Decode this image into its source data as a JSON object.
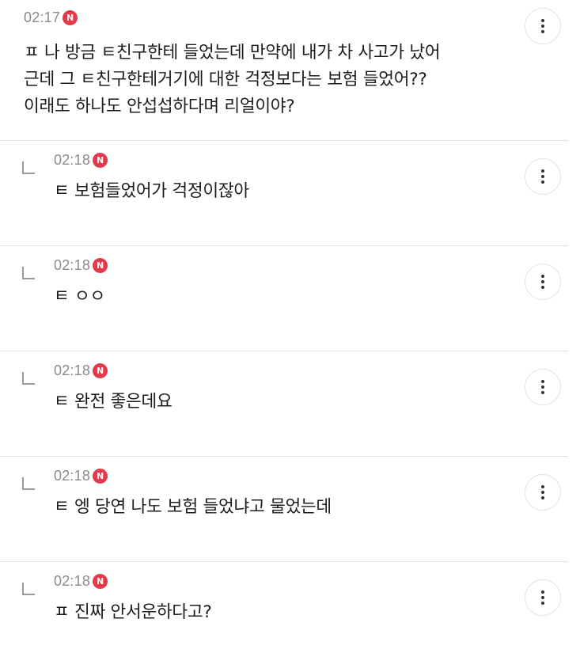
{
  "badge_label": "N",
  "comments": [
    {
      "time": "02:17",
      "text": "ㅍ 나 방금 ㅌ친구한테 들었는데 만약에 내가 차 사고가 났어\n근데 그 ㅌ친구한테거기에 대한 걱정보다는 보험 들었어??\n이래도 하나도 안섭섭하다며 리얼이야?"
    },
    {
      "time": "02:18",
      "text": "ㅌ 보험들었어가 걱정이잖아"
    },
    {
      "time": "02:18",
      "text": "ㅌ ㅇㅇ"
    },
    {
      "time": "02:18",
      "text": "ㅌ 완전 좋은데요"
    },
    {
      "time": "02:18",
      "text": "ㅌ 엥 당연 나도 보험 들었냐고 물었는데"
    },
    {
      "time": "02:18",
      "text": "ㅍ 진짜 안서운하다고?"
    }
  ],
  "colors": {
    "badge": "#e3394a",
    "time": "#8b8b8b",
    "divider": "#e3e3e3",
    "text": "#1c1c1c"
  },
  "icons": {
    "more": "more-vertical-icon",
    "reply": "reply-arrow-icon",
    "new": "new-badge-icon"
  }
}
